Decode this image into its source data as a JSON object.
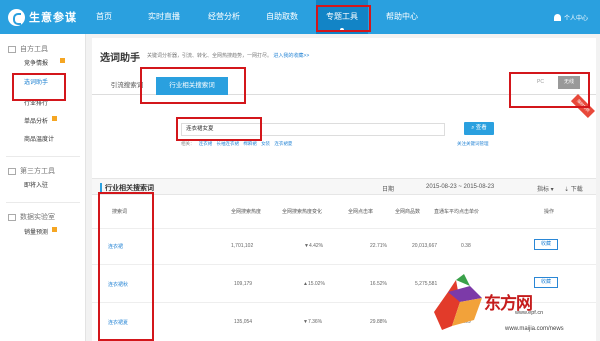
{
  "app": {
    "logo_text": "生意参谋",
    "logo_icon": "logo-icon"
  },
  "topnav": {
    "items": [
      {
        "label": "首页"
      },
      {
        "label": "实时直播"
      },
      {
        "label": "经营分析"
      },
      {
        "label": "自助取数"
      },
      {
        "label": "专题工具"
      },
      {
        "label": "帮助中心"
      }
    ],
    "active_index": 4,
    "user_label": "个人中心"
  },
  "sidebar": {
    "groups": [
      {
        "label": "自方工具",
        "items": [
          "竞争情报",
          "选词助手",
          "行业排行",
          "单品分析",
          "商品温度计"
        ]
      },
      {
        "label": "第三方工具",
        "items": [
          "即将入驻"
        ]
      },
      {
        "label": "数据实验室",
        "items": [
          "销量预测"
        ]
      }
    ],
    "active_item": "选词助手"
  },
  "page": {
    "title": "选词助手",
    "desc_prefix": "关键词分析器，引流、转化、全网热搜趋势，一网打尽。",
    "desc_link": "进入我的收藏>>"
  },
  "tabs": [
    {
      "label": "引流搜索词"
    },
    {
      "label": "行业相关搜索词"
    }
  ],
  "active_tab": 1,
  "device": {
    "pc_label": "PC",
    "wireless_label": "无线"
  },
  "ribbon": {
    "label": "限时特供"
  },
  "search": {
    "value": "连衣裙女夏",
    "button_label": "查看",
    "hot_prefix": "相关：",
    "hot_words": [
      "连衣裙",
      "长袖连衣裙",
      "棉麻裙",
      "女装",
      "连衣裙夏"
    ],
    "manage_link": "关注关键词管理"
  },
  "section": {
    "title": "行业相关搜索词",
    "date_label": "日期",
    "date_range": "2015-08-23 ~ 2015-08-23",
    "metric_label": "指标",
    "download_label": "下载"
  },
  "table": {
    "headers": [
      "搜索词",
      "全网搜索热度",
      "全网搜索热度变化",
      "全网点击率",
      "全网商品数",
      "直通车平均点击单价",
      "操作"
    ],
    "rows": [
      {
        "keyword": "连衣裙",
        "heat": "1,701,102",
        "change": "▼4.42%",
        "ctr": "22.71%",
        "items": "20,013,667",
        "cpc": "0.38",
        "op": "收藏"
      },
      {
        "keyword": "连衣裙秋",
        "heat": "109,179",
        "change": "▲15.02%",
        "ctr": "16.52%",
        "items": "5,275,581",
        "cpc": "",
        "op": "收藏"
      },
      {
        "keyword": "连衣裙夏",
        "heat": "135,054",
        "change": "▼7.36%",
        "ctr": "29.88%",
        "items": "",
        "cpc": "1.09",
        "op": "收藏"
      }
    ]
  },
  "watermark": {
    "brand": "东方网",
    "url": "www.epf.cn",
    "url2": "www.maijia.com/news"
  }
}
